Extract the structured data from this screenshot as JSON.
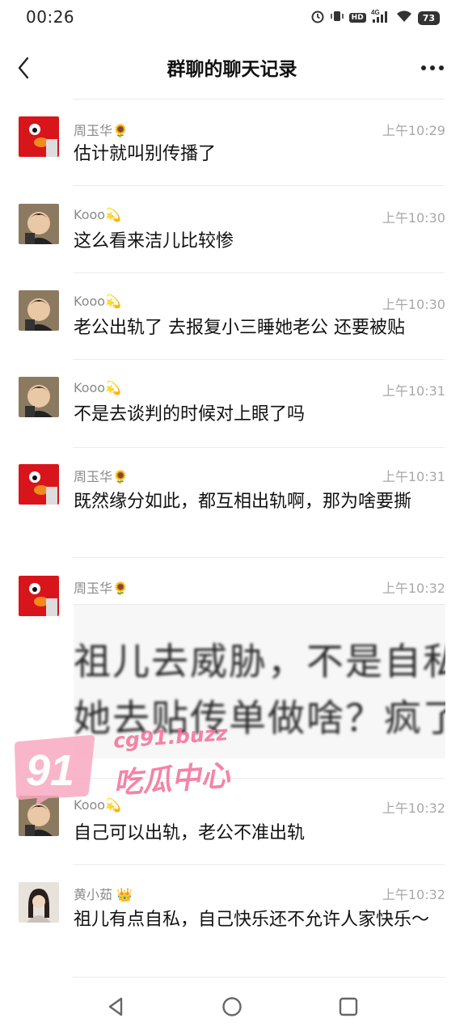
{
  "status": {
    "time": "00:26",
    "battery": "73",
    "network": "4G",
    "hd": "HD"
  },
  "header": {
    "title": "群聊的聊天记录"
  },
  "messages": [
    {
      "sender": "周玉华🌻",
      "time": "上午10:29",
      "text": "估计就叫别传播了",
      "avatar": "elmo"
    },
    {
      "sender": "Kooo💫",
      "time": "上午10:30",
      "text": "这么看来洁儿比较惨",
      "avatar": "boy"
    },
    {
      "sender": "Kooo💫",
      "time": "上午10:30",
      "text": "老公出轨了 去报复小三睡她老公 还要被贴",
      "avatar": "boy"
    },
    {
      "sender": "Kooo💫",
      "time": "上午10:31",
      "text": "不是去谈判的时候对上眼了吗",
      "avatar": "boy"
    },
    {
      "sender": "周玉华🌻",
      "time": "上午10:31",
      "text": "既然缘分如此，都互相出轨啊，那为啥要撕",
      "avatar": "elmo"
    },
    {
      "sender": "周玉华🌻",
      "time": "上午10:32",
      "image_line1": "祖儿去威胁，不是自私",
      "image_line2": "她去贴传单做啥？疯了",
      "avatar": "elmo"
    },
    {
      "sender": "Kooo💫",
      "time": "上午10:32",
      "text": "自己可以出轨，老公不准出轨",
      "avatar": "boy"
    },
    {
      "sender": "黄小茹 👑",
      "time": "上午10:32",
      "text": "祖儿有点自私，自己快乐还不允许人家快乐～",
      "avatar": "girl"
    }
  ],
  "watermark": {
    "number": "91",
    "url": "cg91.buzz",
    "label": "吃瓜中心"
  },
  "colors": {
    "accent_pink": "#f46f97",
    "elmo_red": "#d9151c"
  }
}
